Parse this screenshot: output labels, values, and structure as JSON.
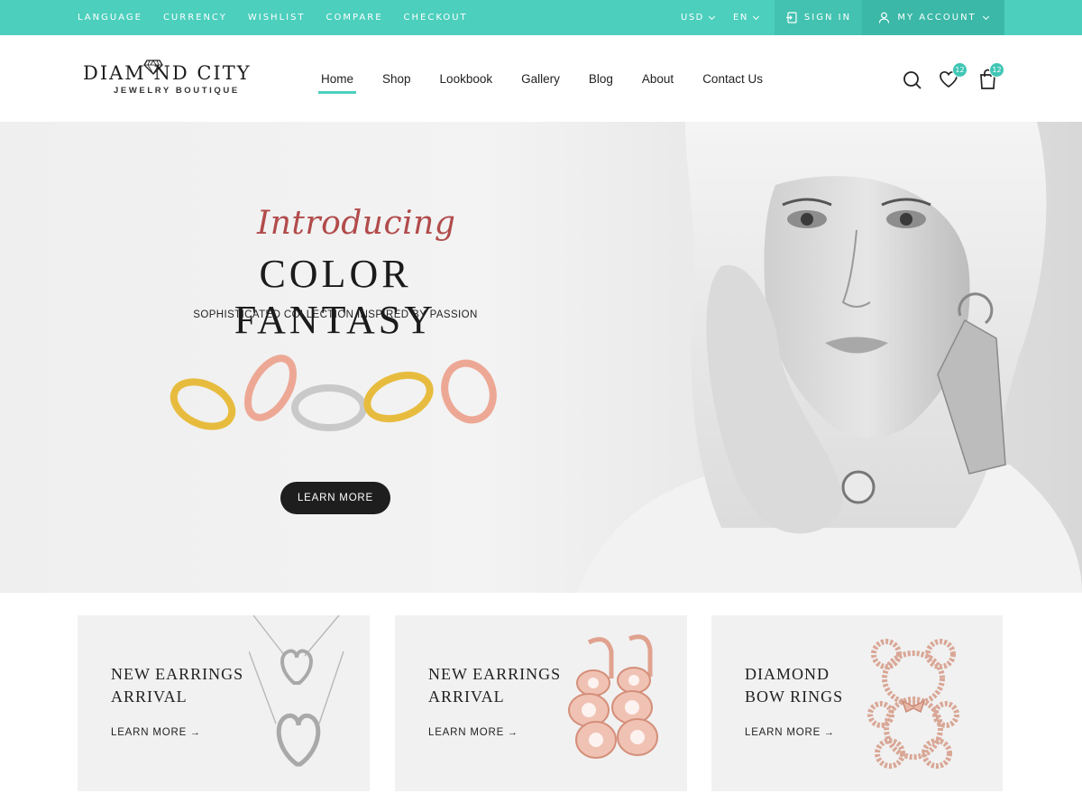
{
  "topbar": {
    "links": [
      "LANGUAGE",
      "CURRENCY",
      "WISHLIST",
      "COMPARE",
      "CHECKOUT"
    ],
    "currency": "USD",
    "language": "EN",
    "sign_in": "SIGN IN",
    "my_account": "MY ACCOUNT"
  },
  "header": {
    "logo_name": "DIAM  ND CITY",
    "logo_sub": "JEWELRY BOUTIQUE",
    "nav": [
      "Home",
      "Shop",
      "Lookbook",
      "Gallery",
      "Blog",
      "About",
      "Contact Us"
    ],
    "wishlist_count": "12",
    "cart_count": "12"
  },
  "hero": {
    "intro": "Introducing",
    "title": "COLOR FANTASY",
    "subtitle": "SOPHISTICATED COLLECTION INSPIRED BY PASSION",
    "button": "LEARN MORE"
  },
  "cards": [
    {
      "line1": "NEW EARRINGS",
      "line2": "ARRIVAL",
      "more": "LEARN MORE",
      "arrow": "→"
    },
    {
      "line1": "NEW EARRINGS",
      "line2": "ARRIVAL",
      "more": "LEARN MORE",
      "arrow": "→"
    },
    {
      "line1": "DIAMOND",
      "line2": "BOW RINGS",
      "more": "LEARN MORE",
      "arrow": "→"
    }
  ],
  "colors": {
    "accent": "#4ccfbd",
    "dark": "#1e1e1e",
    "script": "#b24b4b"
  }
}
